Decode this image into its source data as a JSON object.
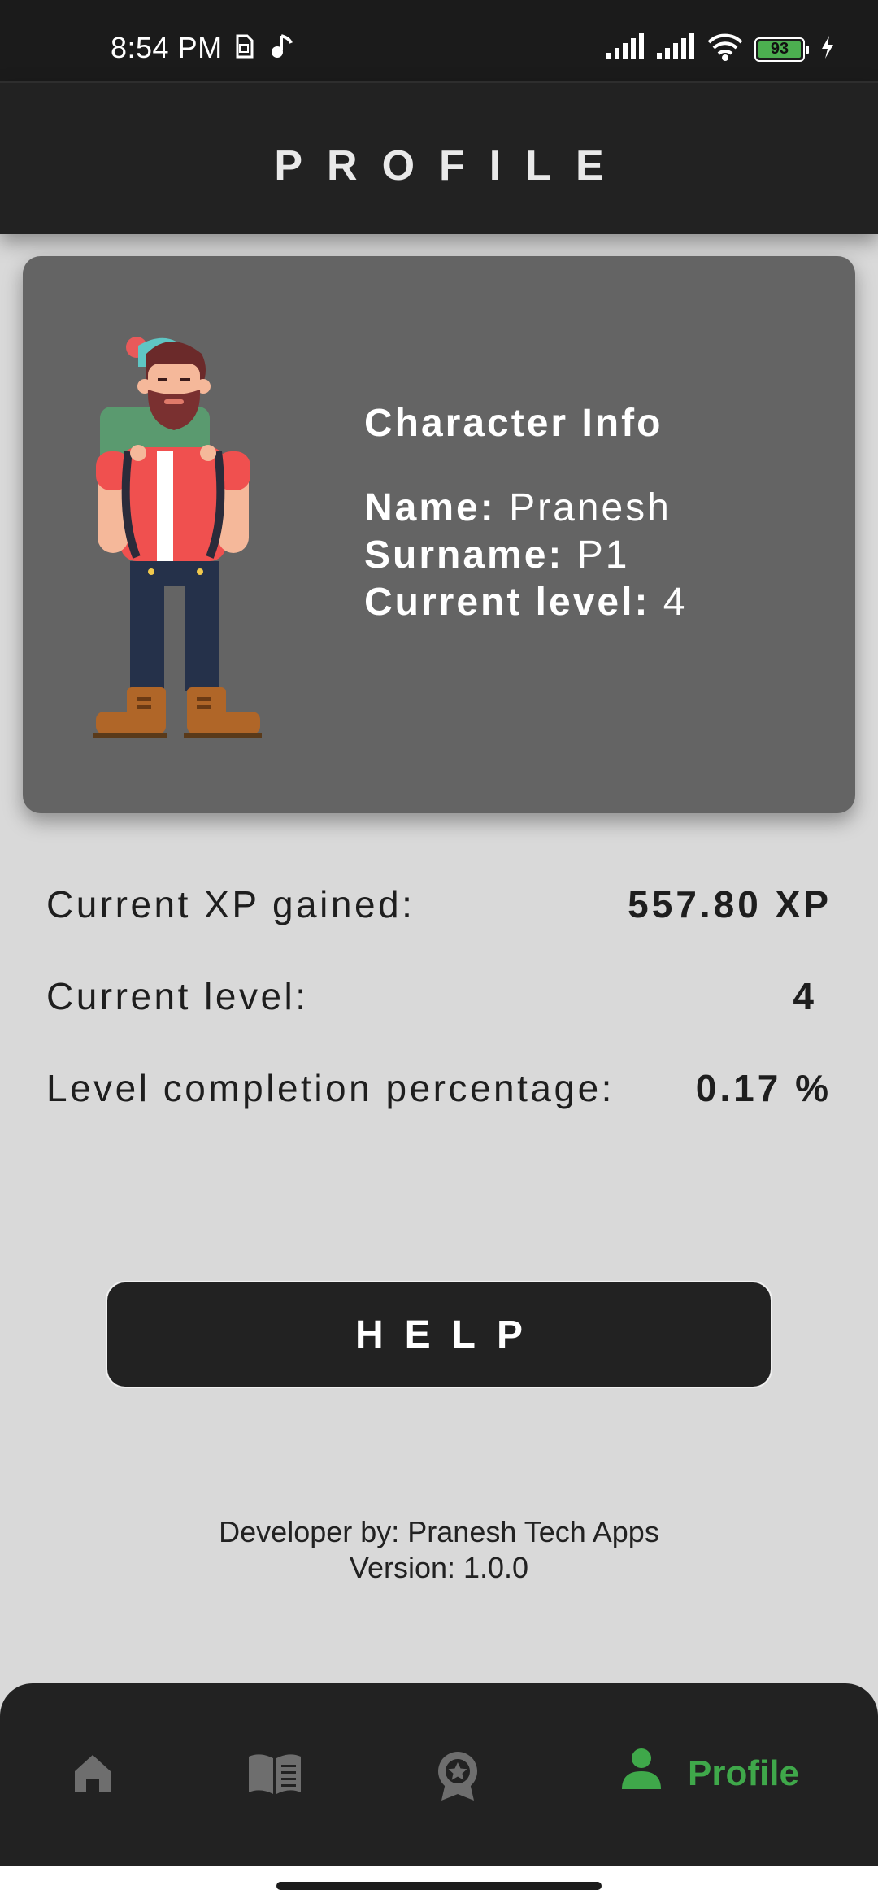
{
  "status_bar": {
    "time": "8:54 PM",
    "battery": "93",
    "icons": [
      "sim-icon",
      "music-note-icon",
      "signal-icon",
      "signal-icon",
      "wifi-icon",
      "battery-icon",
      "charging-icon"
    ]
  },
  "header": {
    "title": "PROFILE"
  },
  "character": {
    "title": "Character Info",
    "name_label": "Name:",
    "name": "Pranesh",
    "surname_label": "Surname:",
    "surname": "P1",
    "level_label": "Current level:",
    "level": "4"
  },
  "stats": {
    "xp_label": "Current XP gained:",
    "xp_value": "557.80 XP",
    "level_label": "Current level:",
    "level_value": "4",
    "completion_label": "Level completion percentage:",
    "completion_value": "0.17 %"
  },
  "help_button": {
    "label": "HELP"
  },
  "footer": {
    "developer": "Developer by: Pranesh Tech Apps",
    "version": "Version: 1.0.0"
  },
  "bottom_nav": {
    "items": [
      {
        "icon": "home-icon"
      },
      {
        "icon": "book-icon"
      },
      {
        "icon": "award-icon"
      },
      {
        "icon": "person-icon",
        "label": "Profile",
        "active": true
      }
    ]
  },
  "colors": {
    "background": "#d9d9d9",
    "header": "#222222",
    "card": "#646464",
    "accent": "#3fa84a",
    "nav_inactive": "#6e6e6e"
  }
}
